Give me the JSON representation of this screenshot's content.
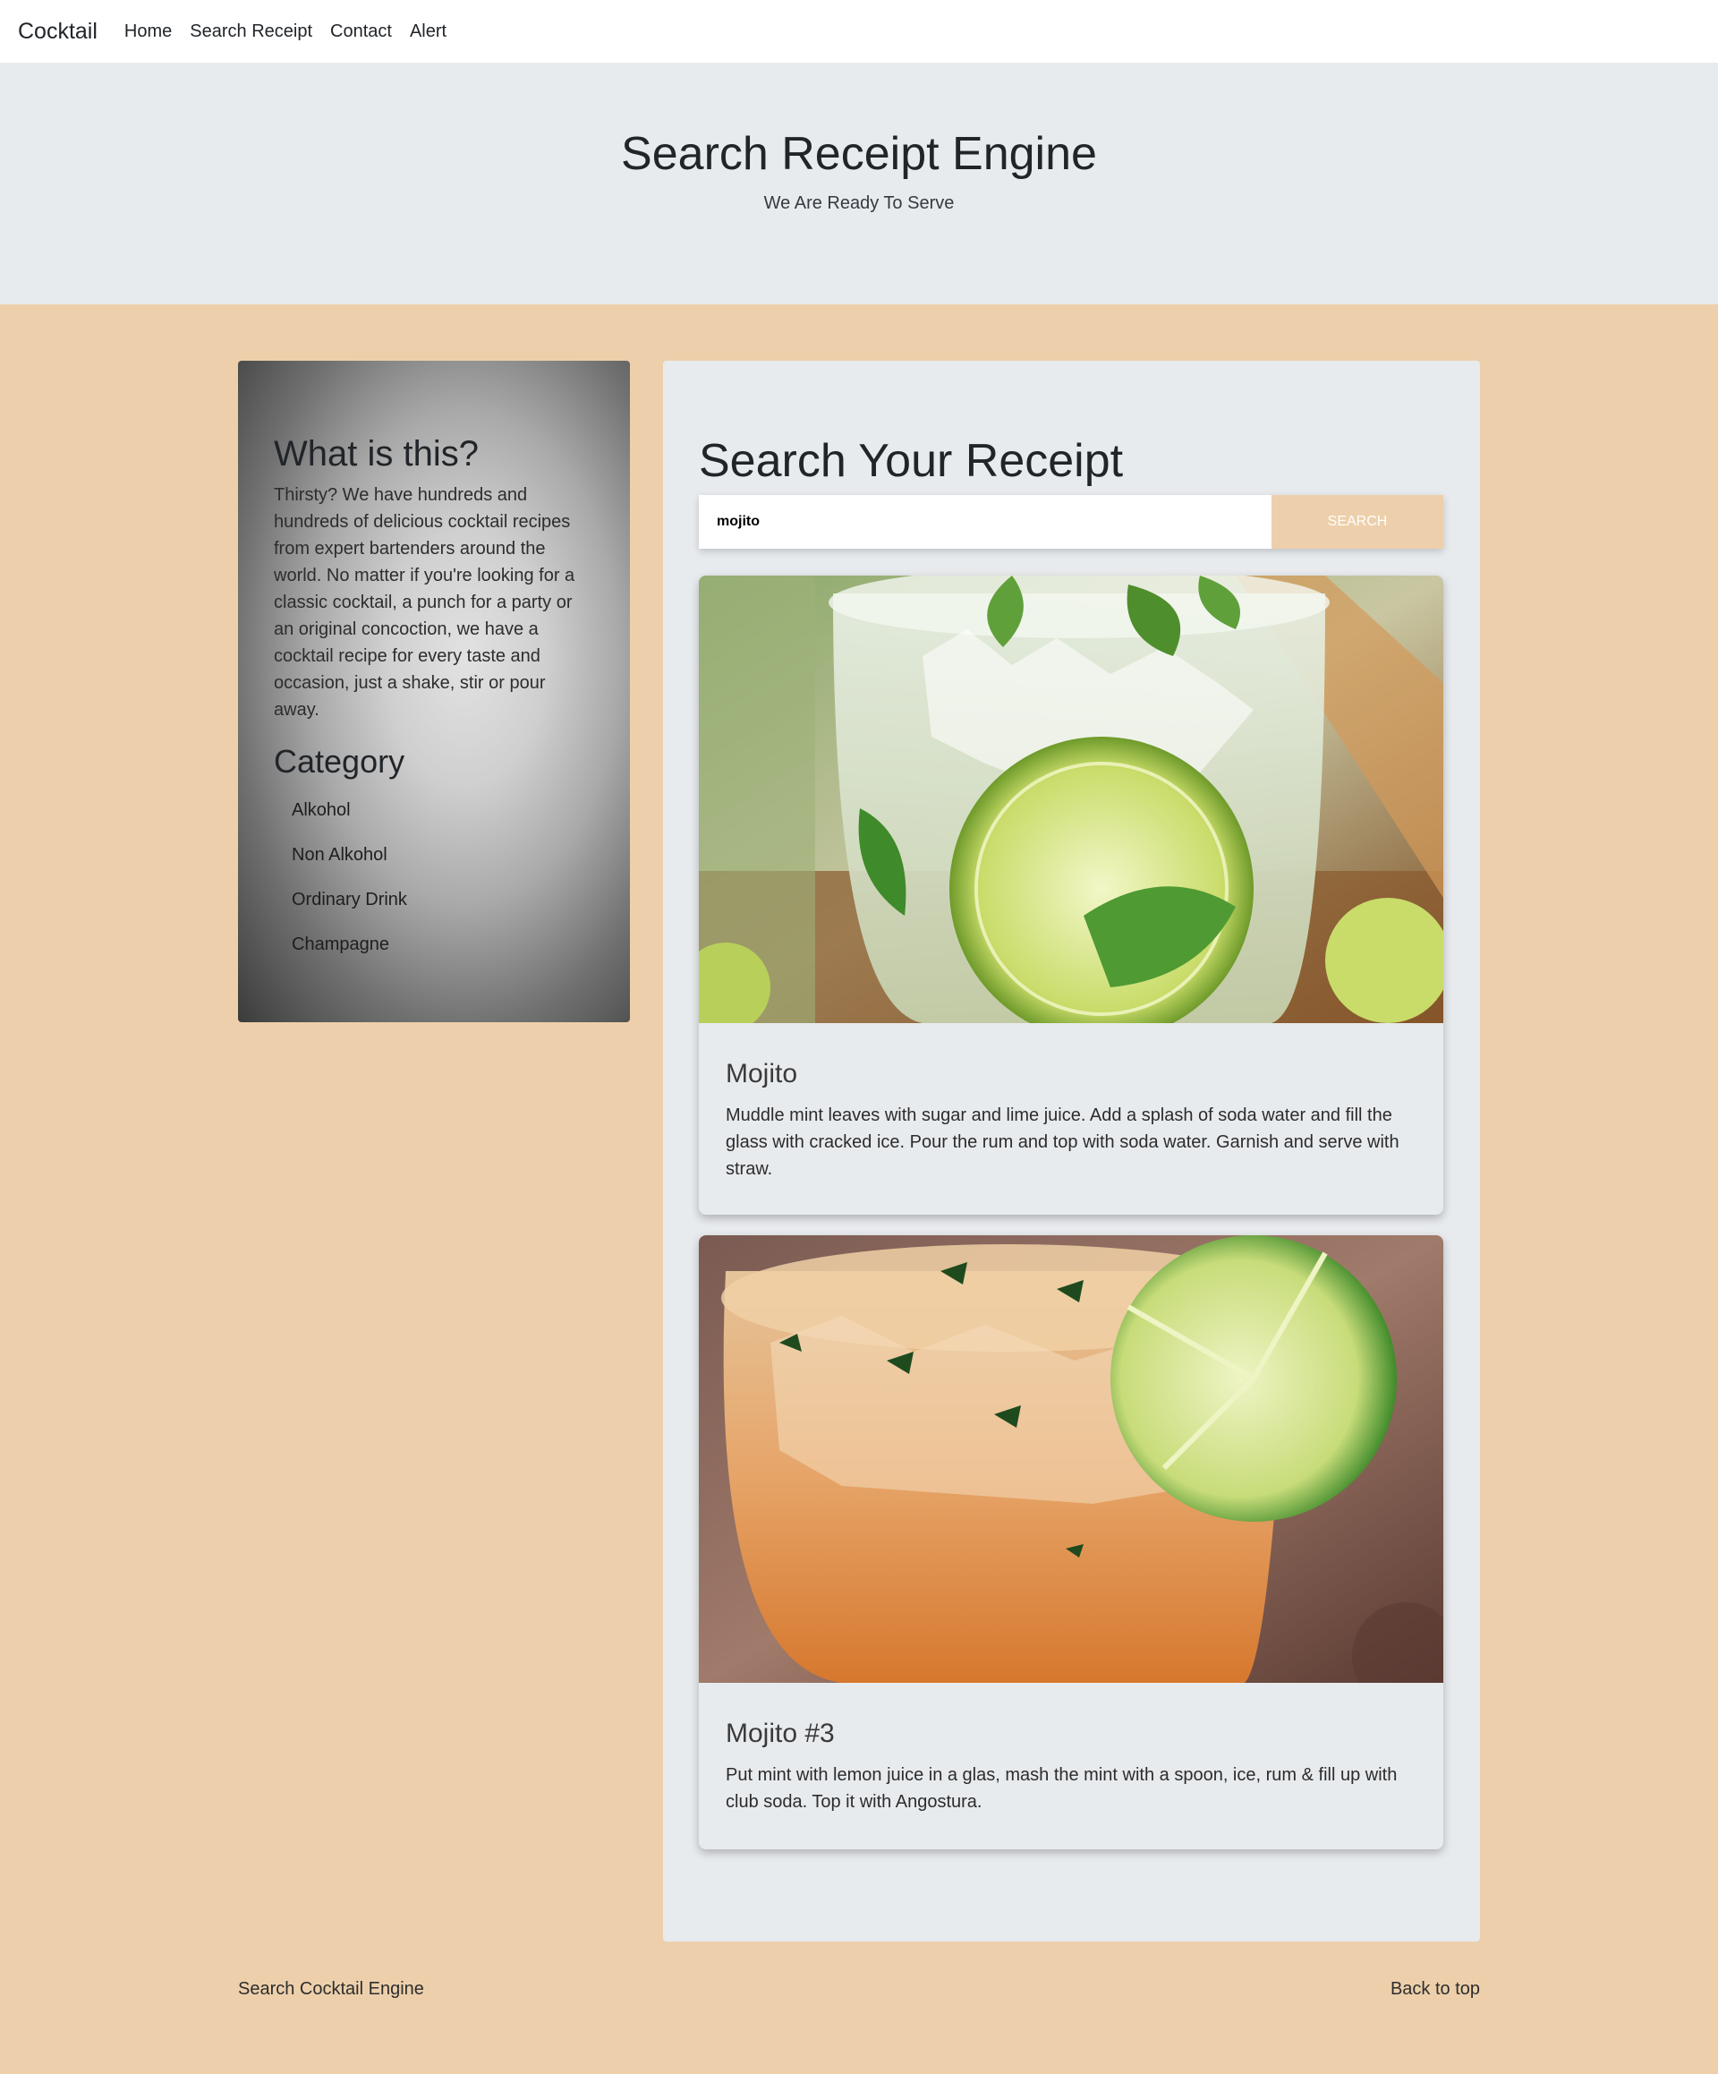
{
  "nav": {
    "brand": "Cocktail",
    "links": [
      "Home",
      "Search Receipt",
      "Contact",
      "Alert"
    ]
  },
  "hero": {
    "title": "Search Receipt Engine",
    "subtitle": "We Are Ready To Serve"
  },
  "sidebar": {
    "heading": "What is this?",
    "intro": "Thirsty? We have hundreds and hundreds of delicious cocktail recipes from expert bartenders around the world. No matter if you're looking for a classic cocktail, a punch for a party or an original concoction, we have a cocktail recipe for every taste and occasion, just a shake, stir or pour away.",
    "category_heading": "Category",
    "categories": [
      "Alkohol",
      "Non Alkohol",
      "Ordinary Drink",
      "Champagne"
    ]
  },
  "search": {
    "heading": "Search Your Receipt",
    "input_value": "mojito",
    "button_label": "SEARCH"
  },
  "results": [
    {
      "title": "Mojito",
      "description": "Muddle mint leaves with sugar and lime juice. Add a splash of soda water and fill the glass with cracked ice. Pour the rum and top with soda water. Garnish and serve with straw."
    },
    {
      "title": "Mojito #3",
      "description": "Put mint with lemon juice in a glas, mash the mint with a spoon, ice, rum & fill up with club soda. Top it with Angostura."
    }
  ],
  "footer": {
    "left": "Search Cocktail Engine",
    "right": "Back to top"
  },
  "colors": {
    "page_background": "#edd0ab",
    "panel_background": "#e8ebee",
    "accent": "#edd0ab"
  }
}
